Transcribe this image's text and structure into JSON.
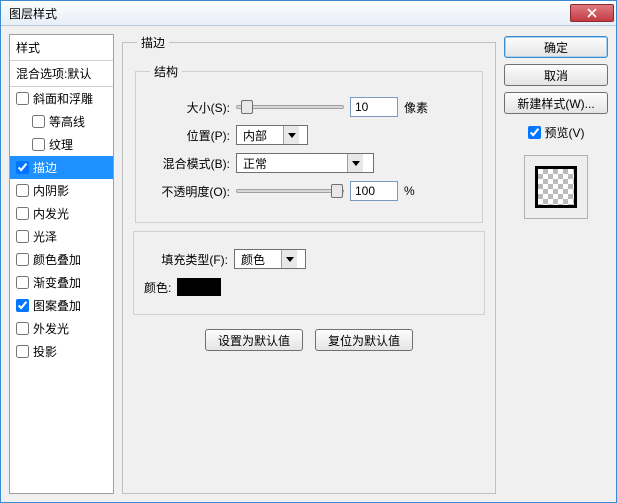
{
  "window": {
    "title": "图层样式"
  },
  "left": {
    "header": "样式",
    "blend_defaults": "混合选项:默认",
    "items": [
      {
        "label": "斜面和浮雕",
        "checked": false
      },
      {
        "label": "等高线",
        "checked": false,
        "indent": true
      },
      {
        "label": "纹理",
        "checked": false,
        "indent": true
      },
      {
        "label": "描边",
        "checked": true,
        "selected": true
      },
      {
        "label": "内阴影",
        "checked": false
      },
      {
        "label": "内发光",
        "checked": false
      },
      {
        "label": "光泽",
        "checked": false
      },
      {
        "label": "颜色叠加",
        "checked": false
      },
      {
        "label": "渐变叠加",
        "checked": false
      },
      {
        "label": "图案叠加",
        "checked": true
      },
      {
        "label": "外发光",
        "checked": false
      },
      {
        "label": "投影",
        "checked": false
      }
    ]
  },
  "center": {
    "outer_legend": "描边",
    "structure_legend": "结构",
    "size_label": "大小(S):",
    "size_value": "10",
    "size_unit": "像素",
    "position_label": "位置(P):",
    "position_value": "内部",
    "blend_label": "混合模式(B):",
    "blend_value": "正常",
    "opacity_label": "不透明度(O):",
    "opacity_value": "100",
    "opacity_unit": "%",
    "fill_type_label": "填充类型(F):",
    "fill_type_value": "颜色",
    "color_label": "颜色:",
    "make_default": "设置为默认值",
    "reset_default": "复位为默认值"
  },
  "right": {
    "ok": "确定",
    "cancel": "取消",
    "new_style": "新建样式(W)...",
    "preview": "预览(V)"
  }
}
